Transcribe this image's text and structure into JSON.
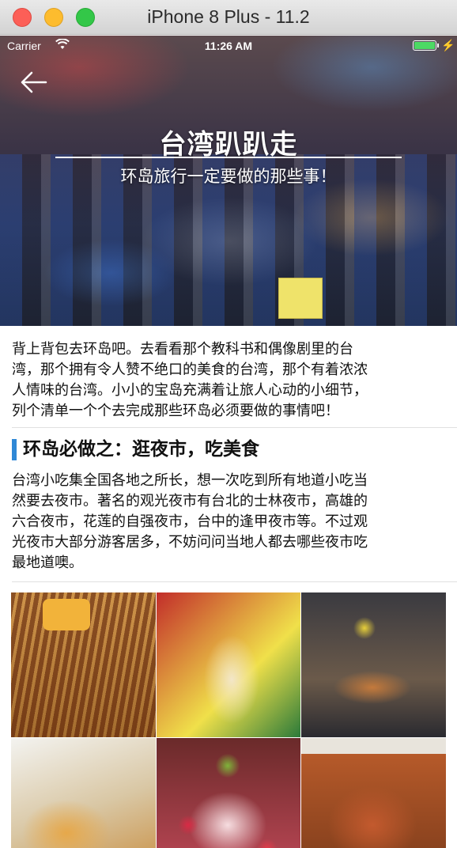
{
  "window": {
    "title": "iPhone 8 Plus - 11.2"
  },
  "status_bar": {
    "carrier": "Carrier",
    "time": "11:26 AM",
    "battery_color": "#4cd964"
  },
  "hero": {
    "title": "台湾趴趴走",
    "subtitle": "环岛旅行一定要做的那些事！"
  },
  "intro": {
    "lines": [
      "背上背包去环岛吧。去看看那个教科书和偶像剧里的台",
      "湾，那个拥有令人赞不绝口的美食的台湾，那个有着浓浓",
      "人情味的台湾。小小的宝岛充满着让旅人心动的小细节，",
      "列个清单一个个去完成那些环岛必须要做的事情吧！"
    ]
  },
  "section": {
    "title": "环岛必做之：逛夜市，吃美食",
    "accent_color": "#2f88d6",
    "lines": [
      "台湾小吃集全国各地之所长，想一次吃到所有地道小吃当",
      "然要去夜市。著名的观光夜市有台北的士林夜市，高雄的",
      "六合夜市，花莲的自强夜市，台中的逢甲夜市等。不过观",
      "光夜市大部分游客居多，不妨问问当地人都去哪些夜市吃",
      "最地道噢。"
    ]
  },
  "photos": [
    {
      "name": "skewers"
    },
    {
      "name": "sausage-bag"
    },
    {
      "name": "night-market-stall"
    },
    {
      "name": "toast"
    },
    {
      "name": "fruit-shaved-ice"
    },
    {
      "name": "oyster-omelette"
    }
  ]
}
